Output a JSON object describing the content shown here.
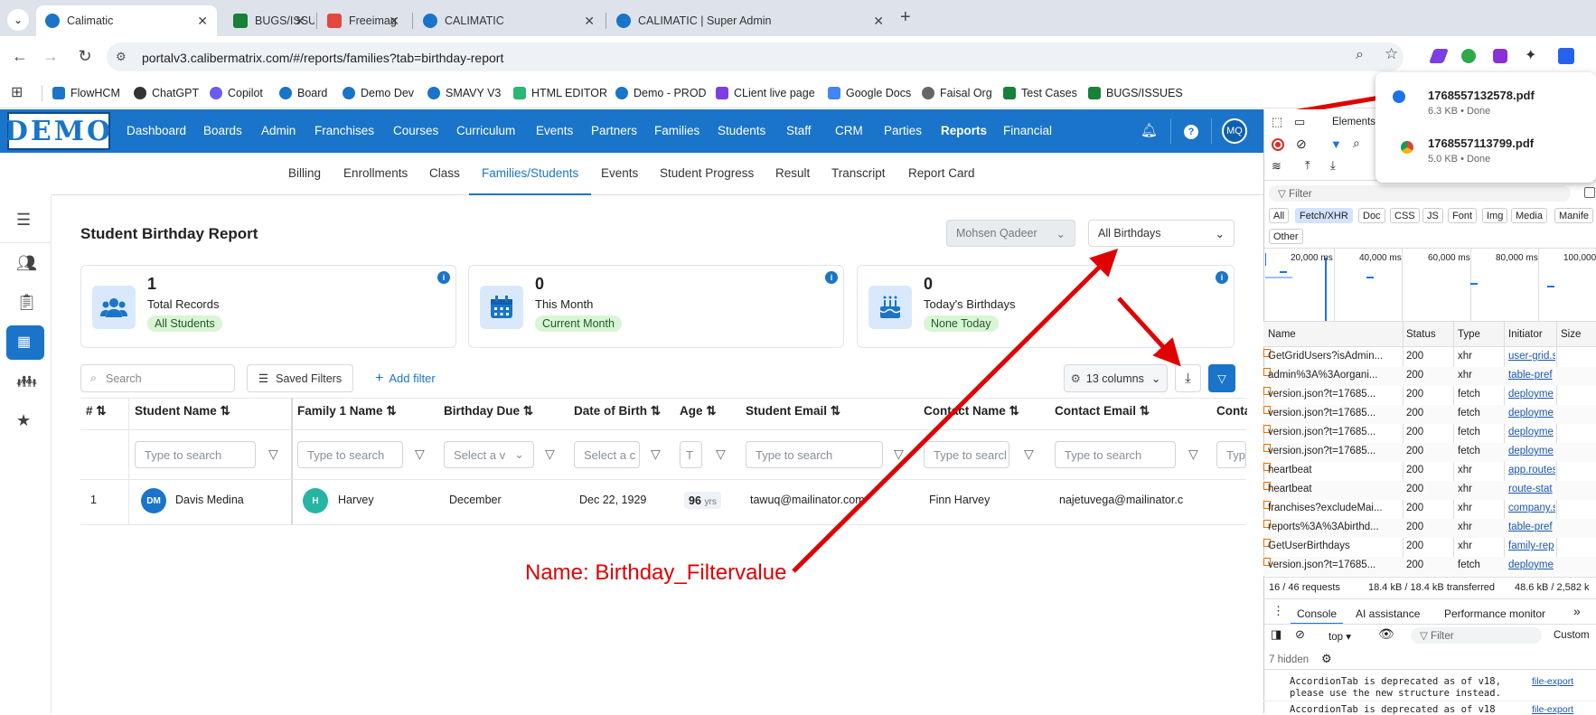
{
  "browser": {
    "tabs": [
      {
        "title": "Calimatic",
        "color": "#1a74c9"
      },
      {
        "title": "BUGS/ISSU",
        "color": "#188038"
      },
      {
        "title": "Freeimag",
        "color": "#e2483d"
      },
      {
        "title": "CALIMATIC",
        "color": "#1a74c9"
      },
      {
        "title": "CALIMATIC | Super Admin",
        "color": "#1a74c9"
      }
    ],
    "url": "portalv3.calibermatrix.com/#/reports/families?tab=birthday-report",
    "bookmarks": [
      "FlowHCM",
      "ChatGPT",
      "Copilot",
      "Board",
      "Demo Dev",
      "SMAVY V3",
      "HTML EDITOR",
      "Demo - PROD",
      "CLient live page",
      "Google Docs",
      "Faisal Org",
      "Test Cases",
      "BUGS/ISSUES"
    ]
  },
  "app": {
    "logo": "DEMO",
    "nav": [
      "Dashboard",
      "Boards",
      "Admin",
      "Franchises",
      "Courses",
      "Curriculum",
      "Events",
      "Partners",
      "Families",
      "Students",
      "Staff",
      "CRM",
      "Parties",
      "Reports",
      "Financial"
    ],
    "user_initials": "MQ",
    "subnav": [
      "Billing",
      "Enrollments",
      "Class",
      "Families/Students",
      "Events",
      "Student Progress",
      "Result",
      "Transcript",
      "Report Card"
    ],
    "page_title": "Student Birthday Report",
    "user_select": "Mohsen Qadeer",
    "birthday_select": "All Birthdays",
    "cards": [
      {
        "value": "1",
        "label": "Total Records",
        "pill": "All Students"
      },
      {
        "value": "0",
        "label": "This Month",
        "pill": "Current Month"
      },
      {
        "value": "0",
        "label": "Today's Birthdays",
        "pill": "None Today"
      }
    ],
    "search_placeholder": "Search",
    "saved_filters": "Saved Filters",
    "add_filter": "Add filter",
    "columns_btn": "13 columns",
    "columns": [
      "#",
      "Student Name",
      "Family 1 Name",
      "Birthday Due",
      "Date of Birth",
      "Age",
      "Student Email",
      "Contact Name",
      "Contact Email",
      "Conta"
    ],
    "filters": [
      "Type to search",
      "Type to search",
      "Select a v",
      "Select a c",
      "T",
      "Type to search",
      "Type to searcl",
      "Type to search",
      "Type"
    ],
    "row": {
      "num": "1",
      "student_initials": "DM",
      "student": "Davis Medina",
      "family_initial": "H",
      "family": "Harvey",
      "birthday_due": "December",
      "dob": "Dec 22, 1929",
      "age": "96",
      "age_unit": "yrs",
      "email": "tawuq@mailinator.com",
      "contact": "Finn Harvey",
      "contact_email": "najetuvega@mailinator.c"
    },
    "annotation": "Name: Birthday_Filtervalue"
  },
  "devtools": {
    "elements_tab": "Elements",
    "filter_placeholder": "Filter",
    "chips": [
      "All",
      "Fetch/XHR",
      "Doc",
      "CSS",
      "JS",
      "Font",
      "Img",
      "Media",
      "Manife",
      "Other"
    ],
    "timeline": [
      "20,000 ms",
      "40,000 ms",
      "60,000 ms",
      "80,000 ms",
      "100,000"
    ],
    "headers": [
      "Name",
      "Status",
      "Type",
      "Initiator",
      "Size"
    ],
    "requests": [
      [
        "GetGridUsers?isAdmin...",
        "200",
        "xhr",
        "user-grid.s"
      ],
      [
        "admin%3A%3Aorgani...",
        "200",
        "xhr",
        "table-pref"
      ],
      [
        "version.json?t=17685...",
        "200",
        "fetch",
        "deployme"
      ],
      [
        "version.json?t=17685...",
        "200",
        "fetch",
        "deployme"
      ],
      [
        "version.json?t=17685...",
        "200",
        "fetch",
        "deployme"
      ],
      [
        "version.json?t=17685...",
        "200",
        "fetch",
        "deployme"
      ],
      [
        "heartbeat",
        "200",
        "xhr",
        "app.routes"
      ],
      [
        "heartbeat",
        "200",
        "xhr",
        "route-stat"
      ],
      [
        "franchises?excludeMai...",
        "200",
        "xhr",
        "company.s"
      ],
      [
        "reports%3A%3Abirthd...",
        "200",
        "xhr",
        "table-pref"
      ],
      [
        "GetUserBirthdays",
        "200",
        "xhr",
        "family-rep"
      ],
      [
        "version.json?t=17685...",
        "200",
        "fetch",
        "deployme"
      ]
    ],
    "summary": [
      "16 / 46 requests",
      "18.4 kB / 18.4 kB transferred",
      "48.6 kB / 2,582 k"
    ],
    "console_tabs": [
      "Console",
      "AI assistance",
      "Performance monitor"
    ],
    "context": "top",
    "custom": "Custom",
    "hidden": "7 hidden",
    "console_lines": [
      "AccordionTab is deprecated as of v18,",
      "please use the new structure instead.",
      "AccordionTab is deprecated as of v18"
    ],
    "console_link": "file-export"
  },
  "downloads": [
    {
      "name": "1768557132578.pdf",
      "meta": "6.3 KB • Done"
    },
    {
      "name": "1768557113799.pdf",
      "meta": "5.0 KB • Done"
    }
  ]
}
